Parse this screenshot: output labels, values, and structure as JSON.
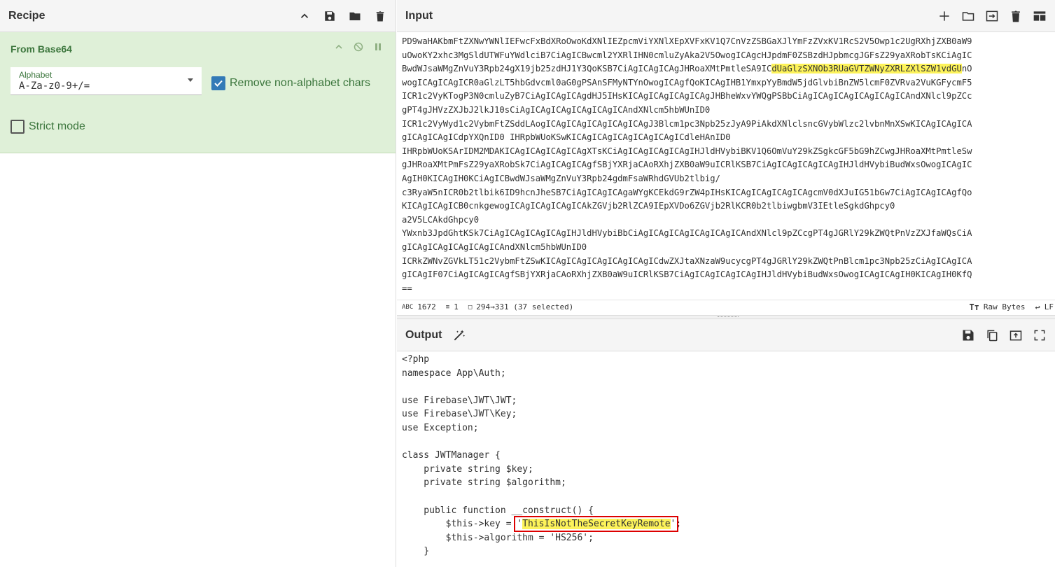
{
  "recipe": {
    "title": "Recipe",
    "header_icons": [
      "chevron-up-icon",
      "save-icon",
      "folder-icon",
      "trash-icon"
    ],
    "operation": {
      "name": "From Base64",
      "alphabet_label": "Alphabet",
      "alphabet_value": "A-Za-z0-9+/=",
      "remove_non_alpha_label": "Remove non-alphabet chars",
      "remove_non_alpha_checked": true,
      "strict_mode_label": "Strict mode",
      "strict_mode_checked": false
    }
  },
  "input": {
    "title": "Input",
    "lines": [
      "PD9waHAKbmFtZXNwYWNlIEFwcFxBdXRoOwoKdXNlIEZpcmViYXNlXEpXVFxKV1Q7CnVzZSBGaXJlYmFzZVxKV1RcS2V5Owp1c2UgRXhjZXB0aW9",
      "uOwoKY2xhc3MgSldUTWFuYWdlciB7CiAgICBwcml2YXRlIHN0cmluZyAka2V5OwogICAgcHJpdmF0ZSBzdHJpbmcgJGFsZ29yaXRobTsKCiAgIC",
      "BwdWJsaWMgZnVuY3Rpb24gX19jb25zdHJ1Y3QoKSB7CiAgICAgICAgJHRoaXMtPmtleSA9IC",
      "wogICAgICAgICR0aGlzLT5hbGdvcml0aG0gPSAnSFMyNTYnOwogICAgfQoKICAgIHB1YmxpYyBmdW5jdGlvbiBnZW5lcmF0ZVRva2VuKGFycmF5",
      "ICR1c2VyKTogP3N0cmluZyB7CiAgICAgICAgdHJ5IHsKICAgICAgICAgICAgJHBheWxvYWQgPSBbCiAgICAgICAgICAgICAgICAndXNlcl9pZCc",
      "gPT4gJHVzZXJbJ2lkJ10sCiAgICAgICAgICAgICAgICAndXNlcm5hbWUnID0",
      "ICR1c2VyWyd1c2VybmFtZSddLAogICAgICAgICAgICAgICAgJ3Blcm1pc3Npb25zJyA9PiAkdXNlclsncGVybWlzc2lvbnMnXSwKICAgICAgICA",
      "gICAgICAgICdpYXQnID0 IHRpbWUoKSwKICAgICAgICAgICAgICAgICdleHAnID0",
      "IHRpbWUoKSArIDM2MDAKICAgICAgICAgICAgXTsKCiAgICAgICAgICAgIHJldHVybiBKV1Q6OmVuY29kZSgkcGF5bG9hZCwgJHRoaXMtPmtleSw",
      "gJHRoaXMtPmFsZ29yaXRobSk7CiAgICAgICAgfSBjYXRjaCAoRXhjZXB0aW9uICRlKSB7CiAgICAgICAgICAgIHJldHVybiBudWxsOwogICAgIC",
      "AgIH0KICAgIH0KCiAgICBwdWJsaWMgZnVuY3Rpb24gdmFsaWRhdGVUb2tlbig/",
      "c3RyaW5nICR0b2tlbik6ID9hcnJheSB7CiAgICAgICAgaWYgKCEkdG9rZW4pIHsKICAgICAgICAgICAgcmV0dXJuIG51bGw7CiAgICAgICAgfQo",
      "KICAgICAgICB0cnkgewogICAgICAgICAgICAkZGVjb2RlZCA9IEpXVDo6ZGVjb2RlKCR0b2tlbiwgbmV3IEtleSgkdGhpcy0",
      "a2V5LCAkdGhpcy0",
      "YWxnb3JpdGhtKSk7CiAgICAgICAgICAgIHJldHVybiBbCiAgICAgICAgICAgICAgICAndXNlcl9pZCcgPT4gJGRlY29kZWQtPnVzZXJfaWQsCiA",
      "gICAgICAgICAgICAgICAndXNlcm5hbWUnID0",
      "ICRkZWNvZGVkLT51c2VybmFtZSwKICAgICAgICAgICAgICAgICdwZXJtaXNzaW9ucycgPT4gJGRlY29kZWQtPnBlcm1pc3Npb25zCiAgICAgICA",
      "gICAgIF07CiAgICAgICAgfSBjYXRjaCAoRXhjZXB0aW9uICRlKSB7CiAgICAgICAgICAgIHJldHVybiBudWxsOwogICAgICAgIH0KICAgIH0KfQ",
      "=="
    ],
    "line3_highlight": "dUaGlzSXNOb3RUaGVTZWNyZXRLZXlSZW1vdGU",
    "line3_tail": "nO",
    "header_icons": [
      "plus-icon",
      "open-folder-icon",
      "import-icon",
      "trash-icon",
      "layout-icon"
    ],
    "status": {
      "length": "1672",
      "lines": "1",
      "selection": "294→331 (37 selected)",
      "raw_bytes": "Raw Bytes",
      "eol": "LF"
    }
  },
  "output": {
    "title": "Output",
    "header_icons": [
      "save-icon",
      "copy-icon",
      "replace-input-icon",
      "maximize-icon"
    ],
    "lines": [
      "<?php",
      "namespace App\\Auth;",
      "",
      "use Firebase\\JWT\\JWT;",
      "use Firebase\\JWT\\Key;",
      "use Exception;",
      "",
      "class JWTManager {",
      "    private string $key;",
      "    private string $algorithm;",
      "",
      "    public function __construct() {"
    ],
    "key_line_prefix": "        $this->key = ",
    "key_value": "ThisIsNotTheSecretKeyRemote",
    "key_line_suffix": ";",
    "algo_line": "        $this->algorithm = 'HS256';",
    "close_line": "    }"
  }
}
